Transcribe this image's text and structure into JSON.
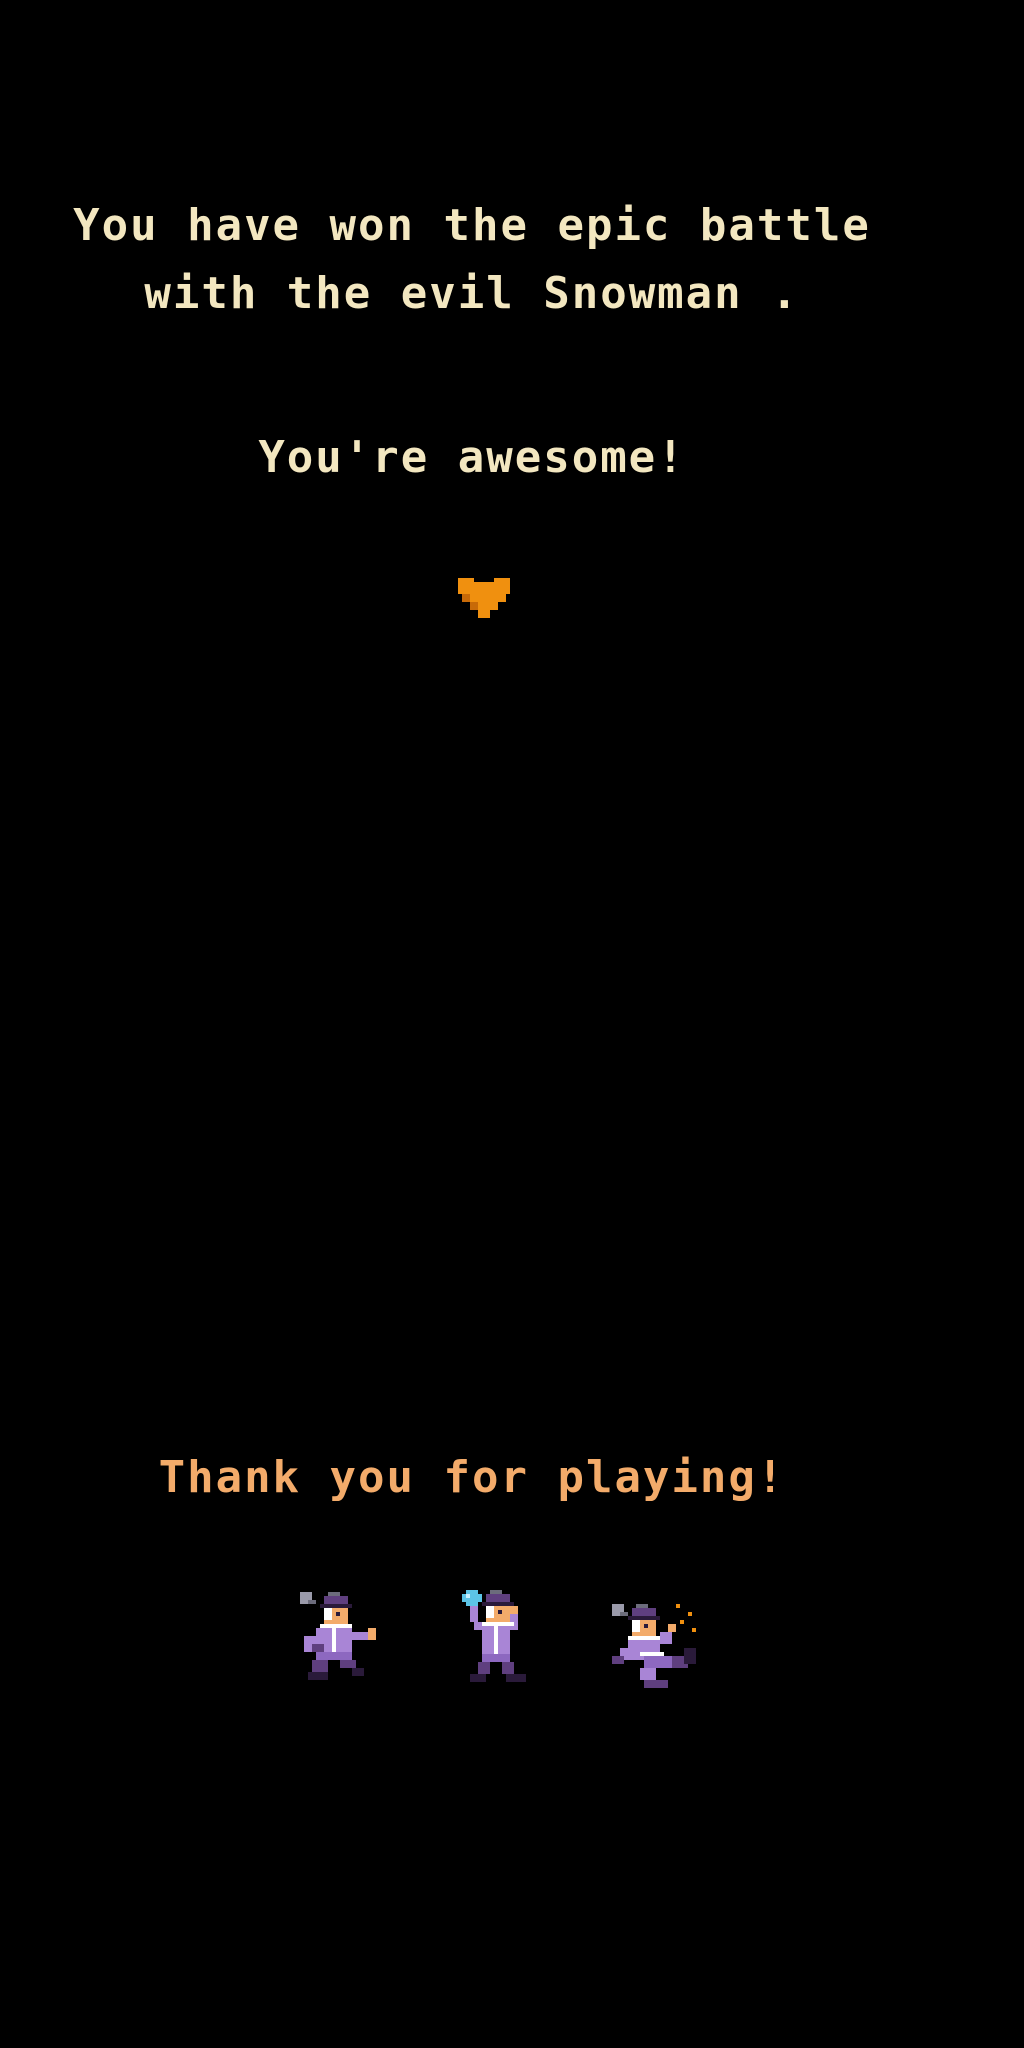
{
  "message": {
    "line1": "You have won the epic battle",
    "line2": "with the evil Snowman .",
    "line3": "You're awesome!"
  },
  "footer": {
    "thanks": "Thank you for playing!"
  },
  "icons": {
    "heart": "heart-icon",
    "characters": [
      "runner-character",
      "cheering-character",
      "kicking-character"
    ]
  },
  "colors": {
    "background": "#000000",
    "message_text": "#f3e7c0",
    "thanks_text": "#f3ab6a",
    "heart": "#f0900f",
    "outfit": "#a985d6",
    "outfit_dark": "#5f3f7f",
    "skin": "#f3ab6a",
    "hat": "#9a9aaa",
    "snowball": "#5cc4e6"
  }
}
